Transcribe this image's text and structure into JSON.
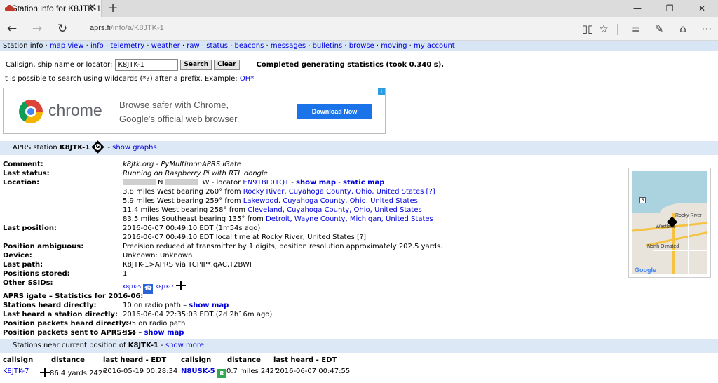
{
  "browser": {
    "tab_title": "Station info for K8JTK-1",
    "tab_close": "✕",
    "new_tab": "+",
    "url_host": "aprs.fi",
    "url_path": "/info/a/K8JTK-1",
    "window_controls": {
      "minimize": "—",
      "restore": "❐",
      "close": "✕"
    }
  },
  "menu": {
    "items": [
      {
        "label": "Station info",
        "link": false
      },
      {
        "label": "map view",
        "link": true
      },
      {
        "label": "info",
        "link": true
      },
      {
        "label": "telemetry",
        "link": true
      },
      {
        "label": "weather",
        "link": true
      },
      {
        "label": "raw",
        "link": true
      },
      {
        "label": "status",
        "link": true
      },
      {
        "label": "beacons",
        "link": true
      },
      {
        "label": "messages",
        "link": true
      },
      {
        "label": "bulletins",
        "link": true
      },
      {
        "label": "browse",
        "link": true
      },
      {
        "label": "moving",
        "link": true
      },
      {
        "label": "my account",
        "link": true
      }
    ]
  },
  "search": {
    "label": "Callsign, ship name or locator:",
    "value": "K8JTK-1",
    "search_button": "Search",
    "clear_button": "Clear",
    "status": "Completed generating statistics (took 0.340 s).",
    "wildcard_text": "It is possible to search using wildcards (*?) after a prefix. Example: ",
    "wildcard_example": "OH*"
  },
  "ad": {
    "brand": "chrome",
    "line1": "Browse safer with Chrome,",
    "line2": "Google's official web browser.",
    "cta": "Download Now",
    "info": "i"
  },
  "station": {
    "heading_prefix": "APRS station ",
    "callsign": "K8JTK-1",
    "symbol": "G",
    "dash": " - ",
    "graphs_link": "show graphs",
    "comment_label": "Comment:",
    "comment": "k8jtk.org - PyMultimonAPRS iGate",
    "last_status_label": "Last status:",
    "last_status": "Running on Raspberry Pi with RTL dongle",
    "location_label": "Location:",
    "location_n": "N",
    "location_w": "W - locator ",
    "locator": "EN91BL01QT",
    "show_map": "show map",
    "static_map": "static map",
    "loc_sep": " - ",
    "nearby": [
      {
        "text": "3.8 miles West bearing 260° from ",
        "place": "Rocky River, Cuyahoga County, Ohio, United States",
        "ref": "[?]"
      },
      {
        "text": "5.9 miles West bearing 259° from ",
        "place": "Lakewood, Cuyahoga County, Ohio, United States",
        "ref": ""
      },
      {
        "text": "11.4 miles West bearing 258° from ",
        "place": "Cleveland, Cuyahoga County, Ohio, United States",
        "ref": ""
      },
      {
        "text": "83.5 miles Southeast bearing 135° from ",
        "place": "Detroit, Wayne County, Michigan, United States",
        "ref": ""
      }
    ],
    "last_position_label": "Last position:",
    "last_position": "2016-06-07 00:49:10 EDT (1m54s ago)",
    "last_position_local": "2016-06-07 00:49:10 EDT local time at Rocky River, United States [?]",
    "ambiguous_label": "Position ambiguous:",
    "ambiguous": "Precision reduced at transmitter by 1 digits, position resolution approximately 202.5 yards.",
    "device_label": "Device:",
    "device": "Unknown: Unknown",
    "last_path_label": "Last path:",
    "last_path": "K8JTK-1>APRS via TCPIP*,qAC,T2BWI",
    "positions_stored_label": "Positions stored:",
    "positions_stored": "1",
    "other_ssids_label": "Other SSIDs:",
    "ssid1": "K8JTK-5",
    "ssid2": "K8JTK-7"
  },
  "igate": {
    "heading": "APRS igate – Statistics for 2016-06:",
    "heard_label": "Stations heard directly:",
    "heard": "10 on radio path – ",
    "heard_map": "show map",
    "last_heard_label": "Last heard a station directly:",
    "last_heard": "2016-06-04 22:35:03 EDT (2d 2h16m ago)",
    "pkts_label": "Position packets heard directly:",
    "pkts": "395 on radio path",
    "sent_label": "Position packets sent to APRS-IS:",
    "sent": "514 – ",
    "sent_map": "show map"
  },
  "map": {
    "labels": [
      "Rocky River",
      "Westlake",
      "North Olmsted"
    ],
    "route": "6",
    "google": "Google"
  },
  "near": {
    "heading_prefix": "Stations near current position of ",
    "callsign": "K8JTK-1",
    "sep": " - ",
    "more_link": "show more",
    "headers": [
      "callsign",
      "distance",
      "last heard - EDT",
      "callsign",
      "distance",
      "last heard - EDT"
    ],
    "row1": {
      "c1": "K8JTK-7",
      "d1": "86.4 yards 242°",
      "t1": "2016-05-19 00:28:34",
      "c2": "N8USK-5",
      "d2": "0.7 miles 242°",
      "t2": "2016-06-07 00:47:55"
    }
  }
}
